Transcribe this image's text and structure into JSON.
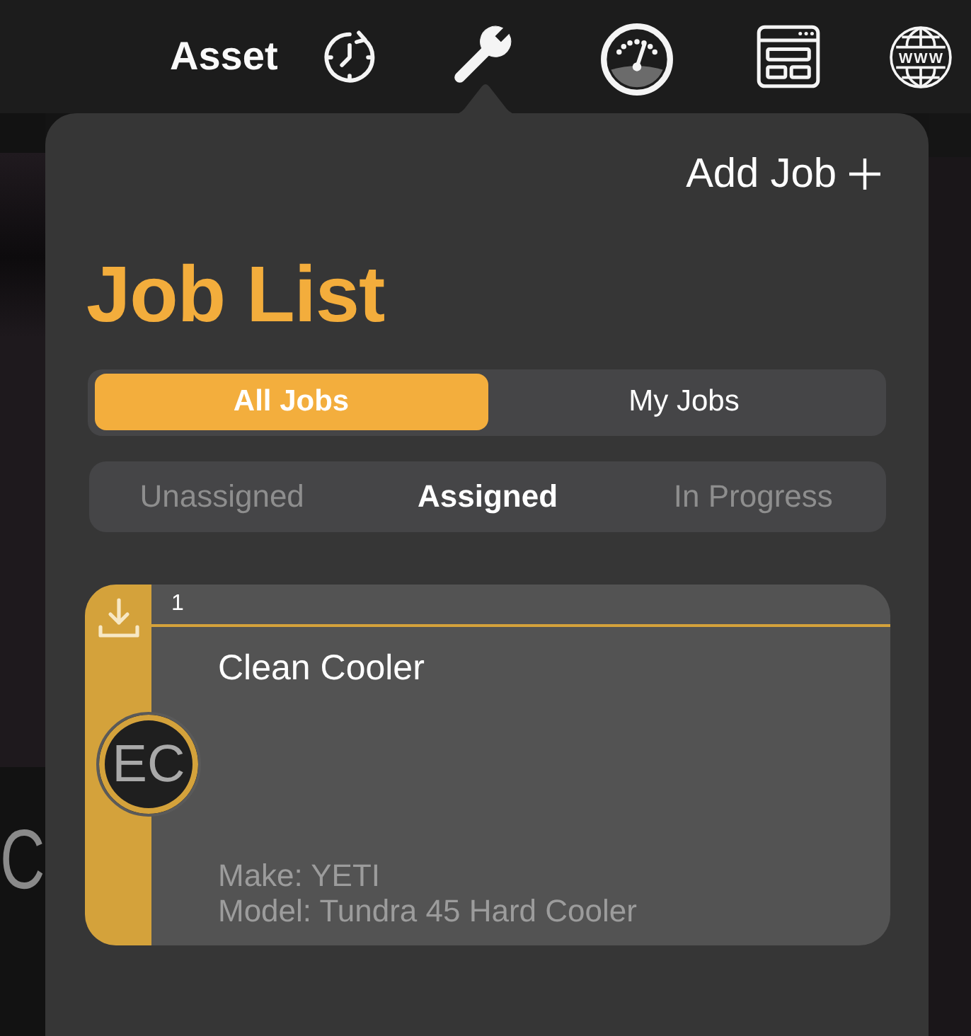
{
  "toolbar": {
    "title": "Asset",
    "globe_text": "WWW"
  },
  "background": {
    "text_fragment": "C"
  },
  "popover": {
    "add_button": "Add Job",
    "title": "Job List",
    "scope_tabs": [
      {
        "label": "All Jobs",
        "selected": true
      },
      {
        "label": "My Jobs",
        "selected": false
      }
    ],
    "status_tabs": [
      {
        "label": "Unassigned",
        "selected": false
      },
      {
        "label": "Assigned",
        "selected": true
      },
      {
        "label": "In Progress",
        "selected": false
      }
    ],
    "jobs": [
      {
        "number": "1",
        "title": "Clean Cooler",
        "initials": "EC",
        "details": [
          "Make: YETI",
          "Model: Tundra 45 Hard Cooler"
        ]
      }
    ]
  }
}
